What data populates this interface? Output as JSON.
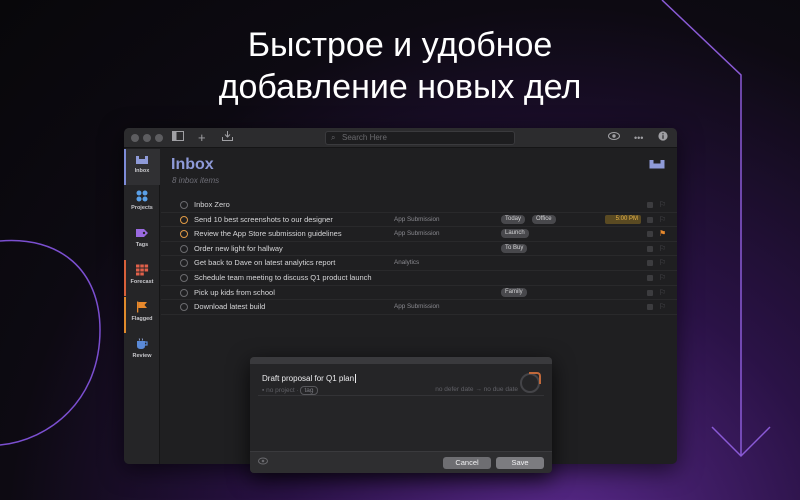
{
  "headline": {
    "line1": "Быстрое и удобное",
    "line2": "добавление новых дел"
  },
  "colors": {
    "accent": "#8e9ad8",
    "due": "#e8b44a",
    "flag": "#e8892c",
    "background_glow": "#5a2a8c"
  },
  "toolbar": {
    "search_placeholder": "Search Here",
    "icons": [
      "sidebar-toggle-icon",
      "add-icon",
      "inbox-download-icon",
      "eye-icon",
      "more-icon",
      "info-icon"
    ]
  },
  "sidebar": {
    "items": [
      {
        "label": "Inbox",
        "icon": "inbox-tray-icon",
        "active": true
      },
      {
        "label": "Projects",
        "icon": "projects-dots-icon",
        "active": false
      },
      {
        "label": "Tags",
        "icon": "tag-icon",
        "active": false
      },
      {
        "label": "Forecast",
        "icon": "forecast-grid-icon",
        "active": false
      },
      {
        "label": "Flagged",
        "icon": "flag-icon",
        "active": false
      },
      {
        "label": "Review",
        "icon": "review-cup-icon",
        "active": false
      }
    ]
  },
  "main": {
    "title": "Inbox",
    "subtitle": "8 inbox items"
  },
  "tasks": [
    {
      "title": "Inbox Zero",
      "project": "",
      "tags": [],
      "due": "",
      "flagged": false,
      "due_soon": false
    },
    {
      "title": "Send 10 best screenshots to our designer",
      "project": "App Submission",
      "tags": [
        "Today",
        "Office"
      ],
      "due": "5:00 PM",
      "flagged": false,
      "due_soon": true
    },
    {
      "title": "Review the App Store submission guidelines",
      "project": "App Submission",
      "tags": [
        "Launch"
      ],
      "due": "",
      "flagged": true,
      "due_soon": true
    },
    {
      "title": "Order new light for hallway",
      "project": "",
      "tags": [
        "To Buy"
      ],
      "due": "",
      "flagged": false,
      "due_soon": false
    },
    {
      "title": "Get back to Dave on latest analytics report",
      "project": "Analytics",
      "tags": [],
      "due": "",
      "flagged": false,
      "due_soon": false
    },
    {
      "title": "Schedule team meeting to discuss Q1 product launch",
      "project": "",
      "tags": [],
      "due": "",
      "flagged": false,
      "due_soon": false
    },
    {
      "title": "Pick up kids from school",
      "project": "",
      "tags": [
        "Family"
      ],
      "due": "",
      "flagged": false,
      "due_soon": false
    },
    {
      "title": "Download latest build",
      "project": "App Submission",
      "tags": [],
      "due": "",
      "flagged": false,
      "due_soon": false
    }
  ],
  "quick_entry": {
    "title_value": "Draft proposal for Q1 plan",
    "project_placeholder": "no project",
    "tag_placeholder": "tag",
    "defer_placeholder": "no defer date",
    "arrow": "→",
    "due_placeholder": "no due date",
    "cancel_label": "Cancel",
    "save_label": "Save"
  }
}
